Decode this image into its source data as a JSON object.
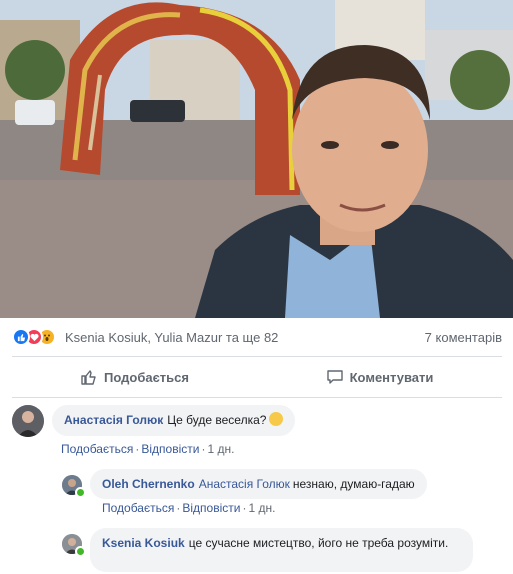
{
  "post": {
    "photo_alt": "selfie photo",
    "reactions": {
      "icons": [
        "like-icon",
        "love-icon",
        "wow-icon"
      ],
      "names": "Ksenia Kosiuk, Yulia Mazur та ще 82",
      "comments_count": "7 коментарів"
    },
    "actions": {
      "like_label": "Подобається",
      "comment_label": "Коментувати"
    }
  },
  "comments": [
    {
      "author": "Анастасія Голюк",
      "text": "Це буде веселка?",
      "like": "Подобається",
      "reply": "Відповісти",
      "time": "1 дн."
    },
    {
      "author": "Oleh Chernenko",
      "mention": "Анастасія Голюк",
      "text": "незнаю, думаю-гадаю",
      "like": "Подобається",
      "reply": "Відповісти",
      "time": "1 дн."
    },
    {
      "author": "Ksenia Kosiuk",
      "text": "це сучасне мистецтво, його не треба розуміти."
    }
  ],
  "colors": {
    "link": "#385898",
    "like_blue": "#1877f2",
    "love_red": "#f33e58",
    "wow_yellow": "#f7b125",
    "bubble": "#f2f3f5"
  }
}
